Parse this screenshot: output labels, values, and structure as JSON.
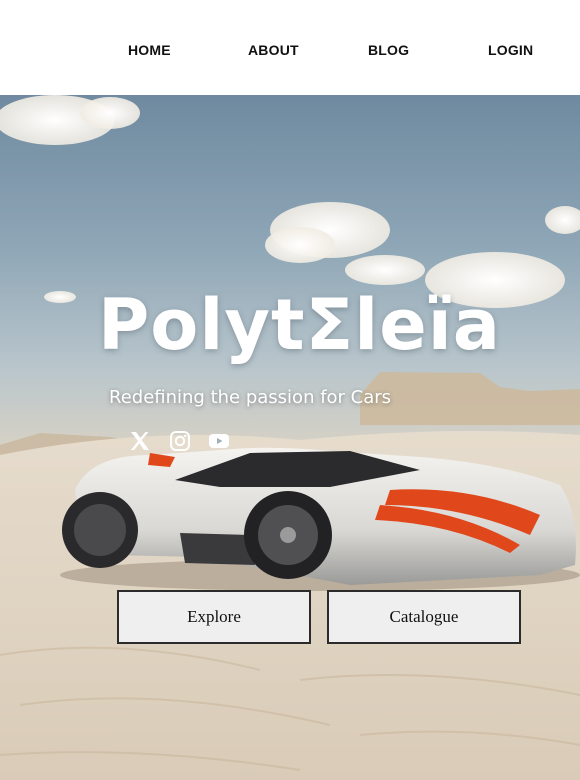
{
  "nav": {
    "home": "HOME",
    "about": "ABOUT",
    "blog": "BLOG",
    "login": "LOGIN"
  },
  "hero": {
    "brand": "PolytΣleïa",
    "tagline": "Redefining the passion for Cars",
    "social_icons": [
      "x-icon",
      "instagram-icon",
      "youtube-icon"
    ],
    "buttons": {
      "explore": "Explore",
      "catalogue": "Catalogue"
    }
  },
  "colors": {
    "nav_bg": "#ffffff",
    "nav_text": "#111111",
    "button_bg": "#efefef",
    "button_border": "#2b2b2b",
    "car_accent": "#e0481c",
    "hero_text": "#ffffff"
  }
}
